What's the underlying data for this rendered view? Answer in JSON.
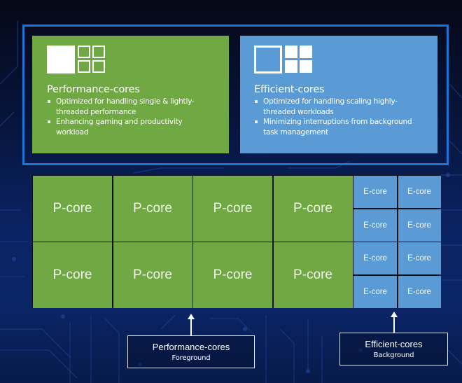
{
  "colors": {
    "background": "#07143a",
    "frame": "#1b74d8",
    "performance_green": "#70a843",
    "efficient_blue": "#5b9bd5",
    "grid_divider": "#0b0f14"
  },
  "cards": {
    "performance": {
      "icon": "performance-core-icon",
      "title": "Performance-cores",
      "bullets": [
        "Optimized for handling single & lightly-threaded performance",
        "Enhancing gaming and productivity workload"
      ]
    },
    "efficient": {
      "icon": "efficient-core-icon",
      "title": "Efficient-cores",
      "bullets": [
        "Optimized for handling scaling highly-threaded workloads",
        "Minimizing interruptions from background task management"
      ]
    }
  },
  "core_layout": {
    "p_core_label": "P-core",
    "e_core_label": "E-core",
    "p_core_count": 8,
    "e_core_count": 8,
    "p_cores": [
      "P-core",
      "P-core",
      "P-core",
      "P-core",
      "P-core",
      "P-core",
      "P-core",
      "P-core"
    ],
    "e_cores": [
      "E-core",
      "E-core",
      "E-core",
      "E-core",
      "E-core",
      "E-core",
      "E-core",
      "E-core"
    ]
  },
  "labels": {
    "performance": {
      "title": "Performance-cores",
      "subtitle": "Foreground"
    },
    "efficient": {
      "title": "Efficient-cores",
      "subtitle": "Background"
    }
  }
}
